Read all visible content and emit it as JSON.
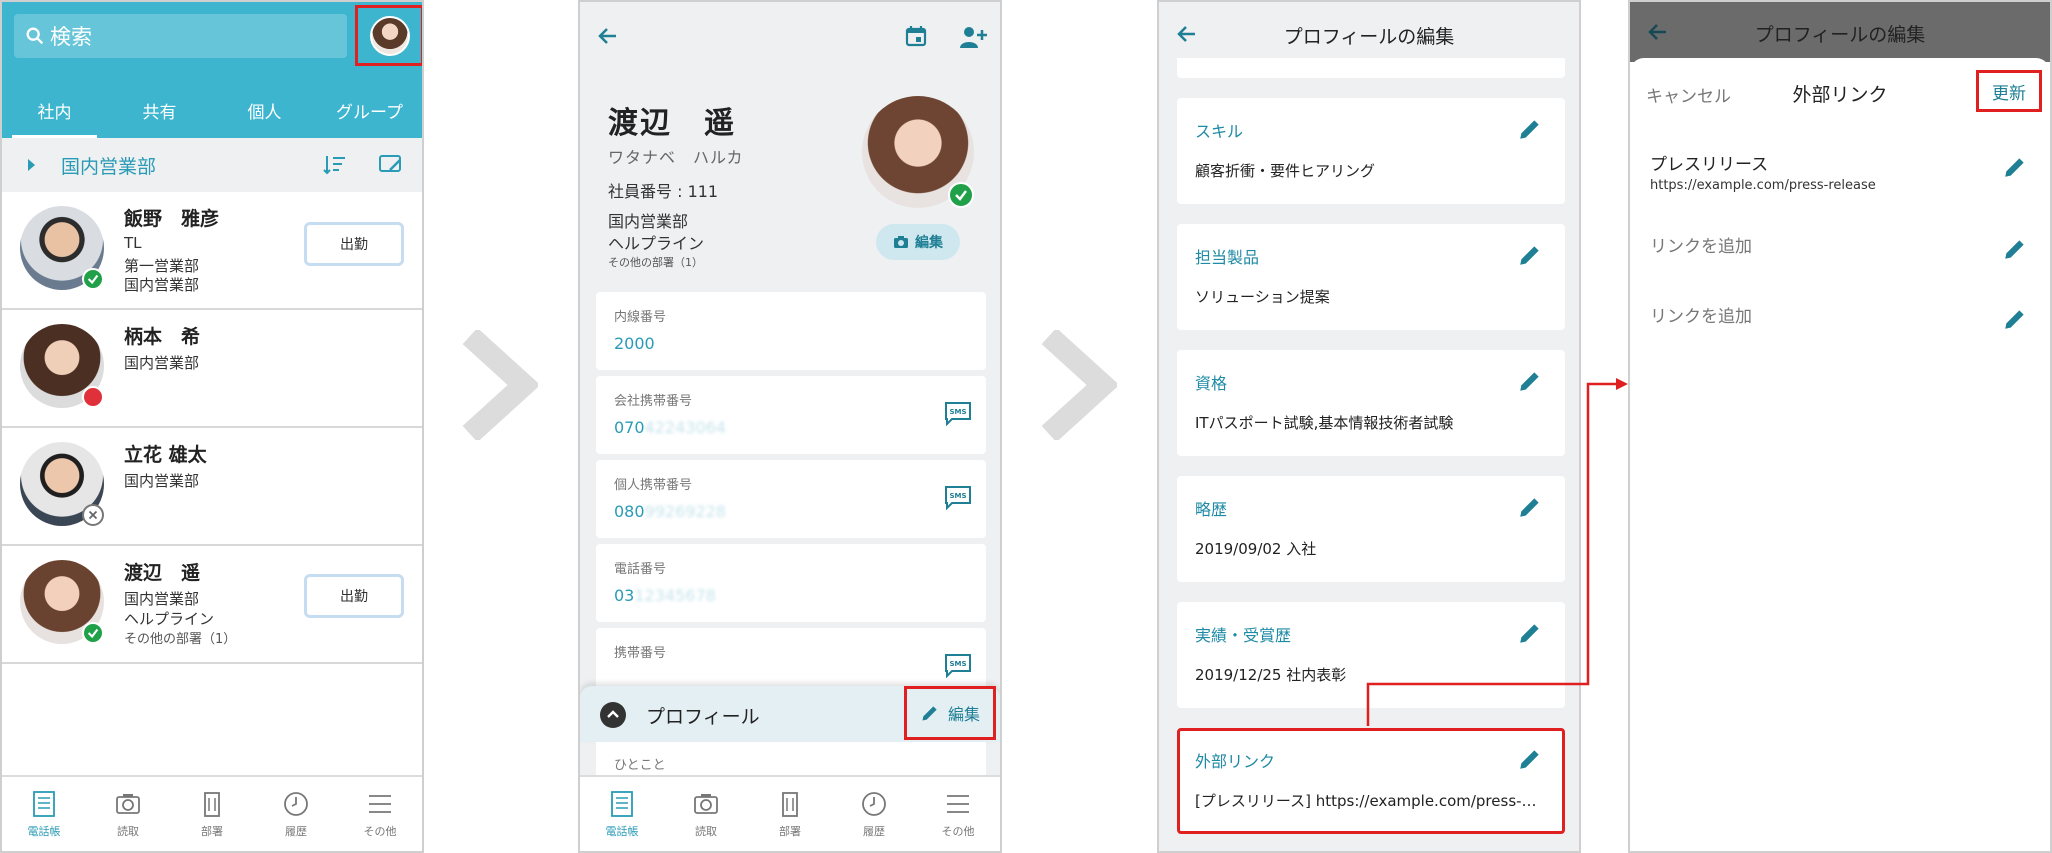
{
  "screen1": {
    "search_placeholder": "検索",
    "tabs": [
      "社内",
      "共有",
      "個人",
      "グループ"
    ],
    "department": "国内営業部",
    "contacts": [
      {
        "name": "飯野　雅彦",
        "lines": [
          "TL",
          "第一営業部",
          "国内営業部"
        ],
        "status": "online",
        "button": "出勤"
      },
      {
        "name": "柄本　希",
        "lines": [
          "国内営業部"
        ],
        "status": "busy",
        "button": ""
      },
      {
        "name": "立花 雄太",
        "lines": [
          "国内営業部"
        ],
        "status": "offline",
        "button": ""
      },
      {
        "name": "渡辺　遥",
        "lines": [
          "国内営業部",
          "ヘルプライン",
          "その他の部署（1）"
        ],
        "status": "online",
        "button": "出勤"
      }
    ]
  },
  "bottom_nav": [
    "電話帳",
    "読取",
    "部署",
    "履歴",
    "その他"
  ],
  "screen2": {
    "name": "渡辺　遥",
    "kana": "ワタナベ　ハルカ",
    "employee_no": "社員番号 : 111",
    "dept": "国内営業部",
    "sub_dept": "ヘルプライン",
    "other_depts": "その他の部署（1）",
    "edit_photo_label": "編集",
    "fields": [
      {
        "label": "内線番号",
        "value": "2000",
        "hidden": ""
      },
      {
        "label": "会社携帯番号",
        "value": "070",
        "hidden": "42243064"
      },
      {
        "label": "個人携帯番号",
        "value": "080",
        "hidden": "99269228"
      },
      {
        "label": "電話番号",
        "value": "03",
        "hidden": "12345678"
      },
      {
        "label": "携帯番号",
        "value": "",
        "hidden": ""
      }
    ],
    "profile_title": "プロフィール",
    "profile_edit_label": "編集",
    "hitokoto_label": "ひとこと"
  },
  "screen3": {
    "title": "プロフィールの編集",
    "fields": [
      {
        "label": "スキル",
        "value": "顧客折衝・要件ヒアリング"
      },
      {
        "label": "担当製品",
        "value": "ソリューション提案"
      },
      {
        "label": "資格",
        "value": "ITパスポート試験,基本情報技術者試験"
      },
      {
        "label": "略歴",
        "value": "2019/09/02 入社"
      },
      {
        "label": "実績・受賞歴",
        "value": "2019/12/25 社内表彰"
      },
      {
        "label": "外部リンク",
        "value": "[プレスリリース] https://example.com/press-release"
      }
    ]
  },
  "screen4": {
    "title": "プロフィールの編集",
    "cancel": "キャンセル",
    "sheet_title": "外部リンク",
    "update": "更新",
    "links": [
      {
        "name": "プレスリリース",
        "url": "https://example.com/press-release"
      },
      {
        "name": "リンクを追加",
        "url": ""
      },
      {
        "name": "リンクを追加",
        "url": ""
      }
    ]
  },
  "colors": {
    "brand": "#3db5cf",
    "accent_text": "#1e8aa5",
    "highlight": "#e02020",
    "online": "#21a04a",
    "busy": "#e0303a"
  },
  "icons": [
    "search-icon",
    "back-icon",
    "calendar-icon",
    "add-user-icon",
    "sms-icon",
    "pencil-icon",
    "camera-icon",
    "sort-icon",
    "edit-list-icon",
    "chevron-up-icon",
    "check-icon",
    "close-icon",
    "chevron-right-icon"
  ]
}
